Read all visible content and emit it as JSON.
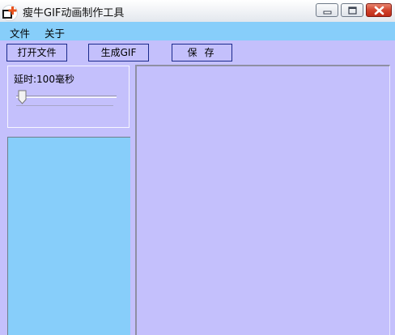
{
  "window": {
    "title": "瘦牛GIF动画制作工具",
    "icon": "app-logo-icon",
    "controls": [
      "minimize-icon",
      "maximize-icon",
      "close-icon"
    ]
  },
  "menu": {
    "items": [
      {
        "label": "文件"
      },
      {
        "label": "关于"
      }
    ]
  },
  "toolbar": {
    "open_label": "打开文件",
    "make_gif_label": "生成GIF",
    "save_label": "保存"
  },
  "delay": {
    "label": "延时:100毫秒",
    "value_fraction": 0.0
  },
  "colors": {
    "background": "#c4c0fc",
    "menubar": "#87cefa",
    "frames_panel": "#87cefa",
    "close_button": "#d1442d"
  }
}
